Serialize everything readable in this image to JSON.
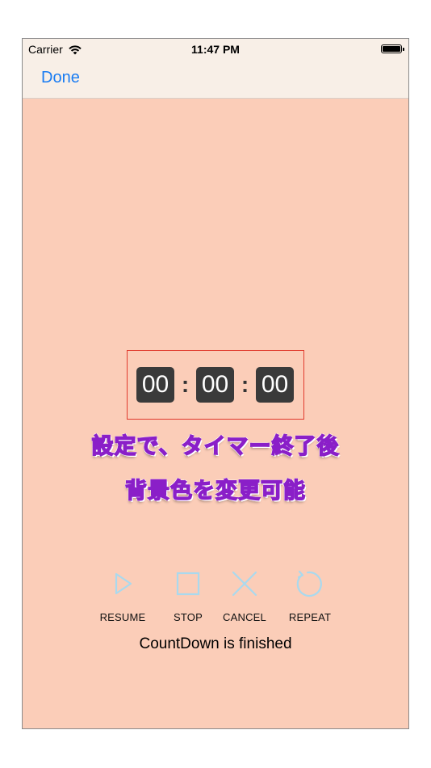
{
  "status_bar": {
    "carrier": "Carrier",
    "wifi_icon": "wifi-icon",
    "time": "11:47 PM",
    "battery_icon": "battery-full-icon"
  },
  "nav": {
    "done_label": "Done"
  },
  "timer": {
    "hours": "00",
    "minutes": "00",
    "seconds": "00",
    "separator": ":"
  },
  "captions": {
    "line1": "設定で、タイマー終了後",
    "line2": "背景色を変更可能"
  },
  "controls": [
    {
      "label": "RESUME",
      "icon": "play-icon"
    },
    {
      "label": "STOP",
      "icon": "stop-icon"
    },
    {
      "label": "CANCEL",
      "icon": "close-icon"
    },
    {
      "label": "REPEAT",
      "icon": "repeat-icon"
    }
  ],
  "status_message": "CountDown is finished",
  "colors": {
    "background": "#fbcdb8",
    "bar_background": "#f8efe7",
    "accent": "#1a7cf2",
    "icon_color": "#a9d9ee",
    "timer_frame": "#e03b2e",
    "caption": "#b52ee8"
  }
}
